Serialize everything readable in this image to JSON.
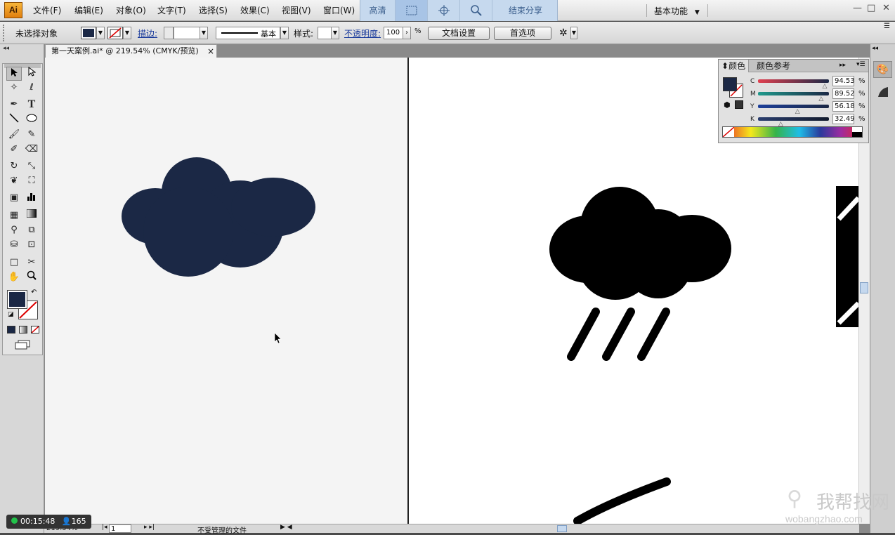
{
  "app": {
    "logo": "Ai"
  },
  "menubar": {
    "items": [
      "文件(F)",
      "编辑(E)",
      "对象(O)",
      "文字(T)",
      "选择(S)",
      "效果(C)",
      "视图(V)",
      "窗口(W)"
    ],
    "share": {
      "hd": "高清",
      "end_share": "结束分享"
    },
    "workspace": "基本功能",
    "window_controls": {
      "minimize": "—",
      "maximize": "□",
      "close": "✕"
    }
  },
  "controlbar": {
    "selection": "未选择对象",
    "stroke_label": "描边:",
    "stroke_style": "基本",
    "style_label": "样式:",
    "opacity_label": "不透明度:",
    "opacity_value": "100",
    "opacity_unit": "%",
    "doc_setup": "文档设置",
    "preferences": "首选项"
  },
  "document": {
    "tab_title": "第一天案例.ai* @ 219.54% (CMYK/预览)",
    "tab_close": "×"
  },
  "colors": {
    "fill": "#1b2845",
    "accent_blue": "#1a3b9c"
  },
  "color_panel": {
    "tabs": [
      "颜色",
      "颜色参考"
    ],
    "channels": [
      {
        "label": "C",
        "value": "94.53",
        "fraction": 0.9453,
        "gradient": "linear-gradient(90deg,#e04050,#1b2845)"
      },
      {
        "label": "M",
        "value": "89.52",
        "fraction": 0.8952,
        "gradient": "linear-gradient(90deg,#1f9a8c,#1b2845)"
      },
      {
        "label": "Y",
        "value": "56.18",
        "fraction": 0.5618,
        "gradient": "linear-gradient(90deg,#1c3f9a,#1b2845)"
      },
      {
        "label": "K",
        "value": "32.49",
        "fraction": 0.3249,
        "gradient": "linear-gradient(90deg,#2a3e6e,#121a2c)"
      }
    ],
    "unit": "%"
  },
  "statusbar": {
    "zoom": "219.54%",
    "page": "1",
    "status_text": "不受管理的文件"
  },
  "recording": {
    "time": "00:15:48",
    "viewers": "165"
  },
  "watermark": {
    "name": "我帮找网",
    "url": "wobangzhao.com"
  }
}
